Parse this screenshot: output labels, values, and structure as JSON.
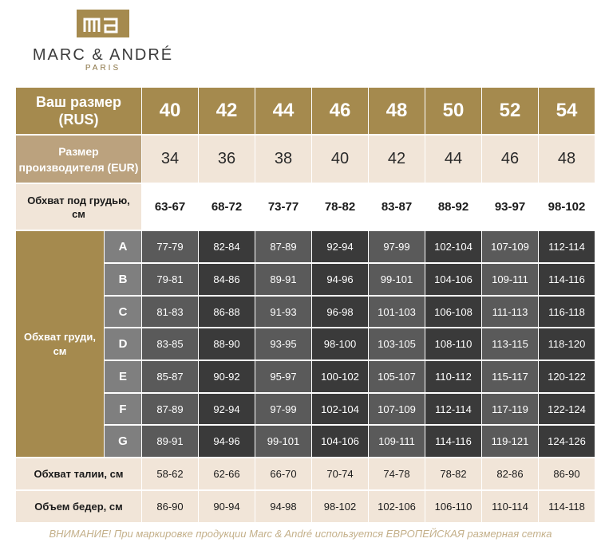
{
  "logo": {
    "monogram": "ma",
    "brand": "MARC & ANDRÉ",
    "city": "PARIS"
  },
  "header": {
    "label": "Ваш размер\n(RUS)",
    "sizes": [
      "40",
      "42",
      "44",
      "46",
      "48",
      "50",
      "52",
      "54"
    ]
  },
  "eur_row": {
    "label": "Размер\nпроизводителя (EUR)",
    "sizes": [
      "34",
      "36",
      "38",
      "40",
      "42",
      "44",
      "46",
      "48"
    ]
  },
  "underbust_row": {
    "label": "Обхват под грудью,\nсм",
    "values": [
      "63-67",
      "68-72",
      "73-77",
      "78-82",
      "83-87",
      "88-92",
      "93-97",
      "98-102"
    ]
  },
  "bust": {
    "label": "Обхват груди,\nсм",
    "cups": [
      {
        "cup": "A",
        "values": [
          "77-79",
          "82-84",
          "87-89",
          "92-94",
          "97-99",
          "102-104",
          "107-109",
          "112-114"
        ]
      },
      {
        "cup": "B",
        "values": [
          "79-81",
          "84-86",
          "89-91",
          "94-96",
          "99-101",
          "104-106",
          "109-111",
          "114-116"
        ]
      },
      {
        "cup": "C",
        "values": [
          "81-83",
          "86-88",
          "91-93",
          "96-98",
          "101-103",
          "106-108",
          "111-113",
          "116-118"
        ]
      },
      {
        "cup": "D",
        "values": [
          "83-85",
          "88-90",
          "93-95",
          "98-100",
          "103-105",
          "108-110",
          "113-115",
          "118-120"
        ]
      },
      {
        "cup": "E",
        "values": [
          "85-87",
          "90-92",
          "95-97",
          "100-102",
          "105-107",
          "110-112",
          "115-117",
          "120-122"
        ]
      },
      {
        "cup": "F",
        "values": [
          "87-89",
          "92-94",
          "97-99",
          "102-104",
          "107-109",
          "112-114",
          "117-119",
          "122-124"
        ]
      },
      {
        "cup": "G",
        "values": [
          "89-91",
          "94-96",
          "99-101",
          "104-106",
          "109-111",
          "114-116",
          "119-121",
          "124-126"
        ]
      }
    ]
  },
  "waist_row": {
    "label": "Обхват талии, см",
    "values": [
      "58-62",
      "62-66",
      "66-70",
      "70-74",
      "74-78",
      "78-82",
      "82-86",
      "86-90"
    ]
  },
  "hips_row": {
    "label": "Объем бедер, см",
    "values": [
      "86-90",
      "90-94",
      "94-98",
      "98-102",
      "102-106",
      "106-110",
      "110-114",
      "114-118"
    ]
  },
  "notice": "ВНИМАНИЕ! При маркировке продукции Marc & André используется ЕВРОПЕЙСКАЯ размерная сетка",
  "colors": {
    "gold": "#A58A4E",
    "light_gold": "#BBA27E",
    "beige": "#F1E5D8",
    "dark": "#3a3a3a",
    "mid": "#5a5a5a",
    "cup_gray": "#7f7f7f",
    "notice": "#C4B08A"
  }
}
